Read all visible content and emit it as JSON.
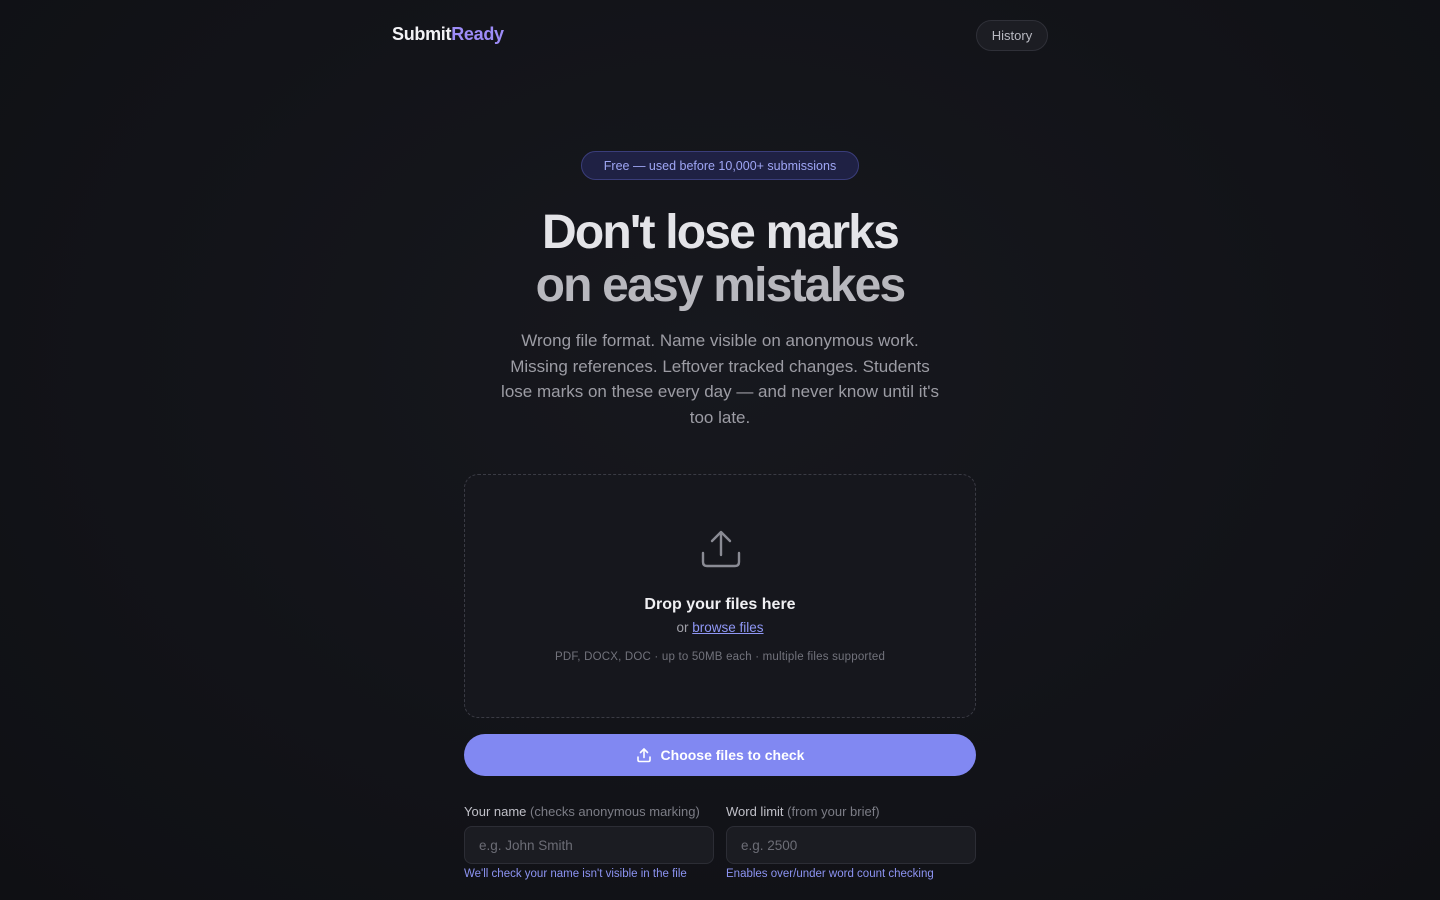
{
  "header": {
    "logo_primary": "Submit",
    "logo_accent": "Ready",
    "history_label": "History"
  },
  "hero": {
    "badge": "Free — used before 10,000+ submissions",
    "headline_line1": "Don't lose marks",
    "headline_line2": "on easy mistakes",
    "subtitle": "Wrong file format. Name visible on anonymous work. Missing references. Leftover tracked changes. Students lose marks on these every day — and never know until it's too late."
  },
  "dropzone": {
    "icon": "upload-icon",
    "title": "Drop your files here",
    "or_text": "or",
    "browse_label": "browse files",
    "hint": "PDF, DOCX, DOC · up to 50MB each · multiple files supported"
  },
  "choose_button": {
    "icon": "upload-icon",
    "label": "Choose files to check"
  },
  "fields": {
    "name": {
      "label": "Your name",
      "label_note": "(checks anonymous marking)",
      "placeholder": "e.g. John Smith",
      "value": "",
      "help": "We'll check your name isn't visible in the file"
    },
    "word_limit": {
      "label": "Word limit",
      "label_note": "(from your brief)",
      "placeholder": "e.g. 2500",
      "value": "",
      "help": "Enables over/under word count checking"
    }
  },
  "colors": {
    "accent": "#8188f2",
    "logo_accent": "#9d8cf7",
    "background": "#121318"
  }
}
